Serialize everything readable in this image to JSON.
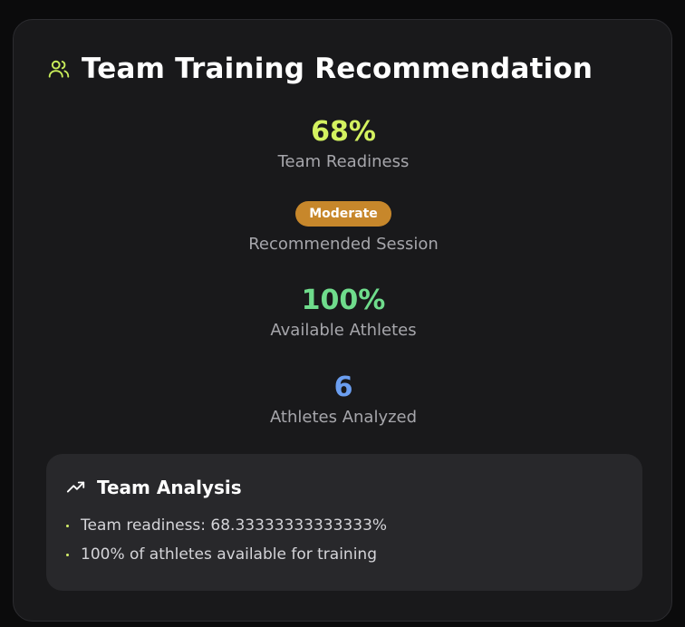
{
  "card": {
    "title": "Team Training Recommendation",
    "icon": "users-icon"
  },
  "stats": {
    "readiness": {
      "value": "68%",
      "label": "Team Readiness",
      "color": "#d4f260"
    },
    "session": {
      "badge": "Moderate",
      "label": "Recommended Session",
      "badge_color": "#c7872b"
    },
    "available": {
      "value": "100%",
      "label": "Available Athletes",
      "color": "#6fdc8c"
    },
    "analyzed": {
      "value": "6",
      "label": "Athletes Analyzed",
      "color": "#6b9ef0"
    }
  },
  "analysis": {
    "title": "Team Analysis",
    "icon": "trending-up-icon",
    "items": [
      "Team readiness: 68.33333333333333%",
      "100% of athletes available for training"
    ]
  }
}
